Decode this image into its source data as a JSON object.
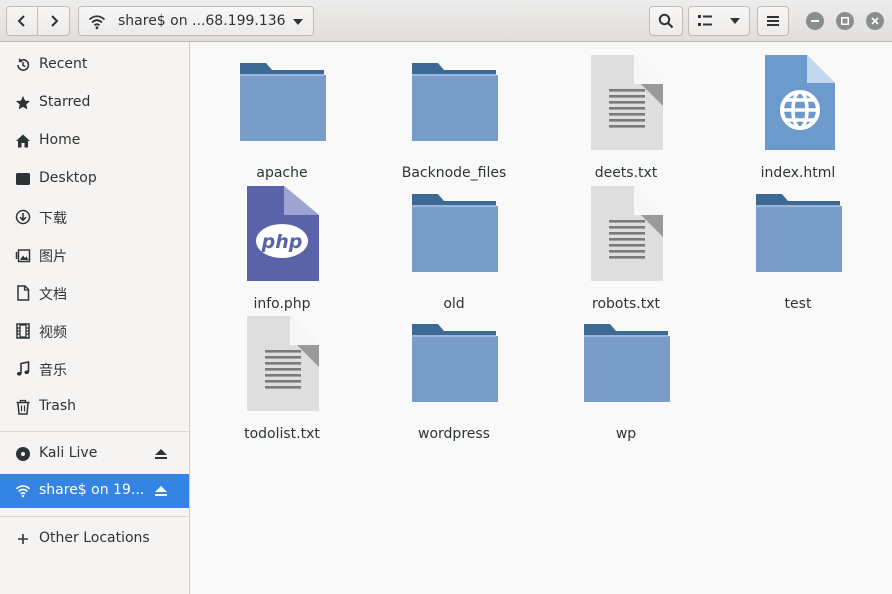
{
  "header": {
    "location": "share$ on ...68.199.136"
  },
  "sidebar": {
    "items": [
      {
        "label": "Recent",
        "icon": "clock-icon"
      },
      {
        "label": "Starred",
        "icon": "star-icon"
      },
      {
        "label": "Home",
        "icon": "home-icon"
      },
      {
        "label": "Desktop",
        "icon": "desktop-icon"
      },
      {
        "label": "下载",
        "icon": "download-icon"
      },
      {
        "label": "图片",
        "icon": "pictures-icon"
      },
      {
        "label": "文档",
        "icon": "document-icon"
      },
      {
        "label": "视频",
        "icon": "video-icon"
      },
      {
        "label": "音乐",
        "icon": "music-icon"
      },
      {
        "label": "Trash",
        "icon": "trash-icon"
      }
    ],
    "devices": [
      {
        "label": "Kali Live",
        "icon": "disc-icon"
      },
      {
        "label": "share$ on 19...",
        "icon": "network-icon",
        "active": true
      }
    ],
    "other": {
      "label": "Other Locations",
      "icon": "plus-icon"
    }
  },
  "files": [
    {
      "name": "apache",
      "type": "folder"
    },
    {
      "name": "Backnode_files",
      "type": "folder"
    },
    {
      "name": "deets.txt",
      "type": "text"
    },
    {
      "name": "index.html",
      "type": "html"
    },
    {
      "name": "info.php",
      "type": "php"
    },
    {
      "name": "old",
      "type": "folder"
    },
    {
      "name": "robots.txt",
      "type": "text"
    },
    {
      "name": "test",
      "type": "folder"
    },
    {
      "name": "todolist.txt",
      "type": "text"
    },
    {
      "name": "wordpress",
      "type": "folder"
    },
    {
      "name": "wp",
      "type": "folder"
    }
  ],
  "colors": {
    "accent": "#3584e4",
    "folder_back": "#3d6a94",
    "folder_front": "#7a9cc9",
    "php": "#5a63a8"
  }
}
